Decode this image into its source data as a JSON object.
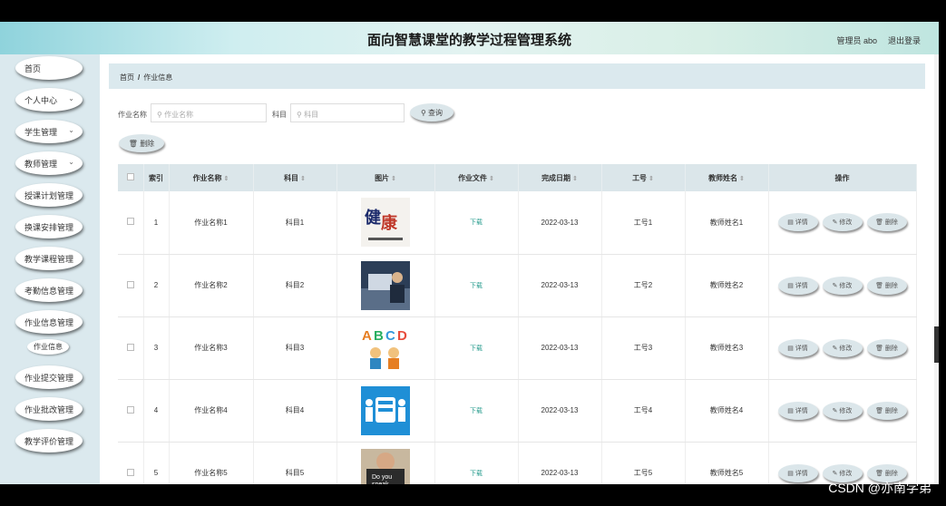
{
  "header": {
    "title": "面向智慧课堂的教学过程管理系统",
    "admin": "管理员 abo",
    "logout": "退出登录"
  },
  "sidebar": {
    "items": [
      {
        "label": "首页",
        "expandable": false
      },
      {
        "label": "个人中心",
        "expandable": true
      },
      {
        "label": "学生管理",
        "expandable": true
      },
      {
        "label": "教师管理",
        "expandable": true
      },
      {
        "label": "授课计划管理",
        "expandable": false
      },
      {
        "label": "换课安排管理",
        "expandable": false
      },
      {
        "label": "教学课程管理",
        "expandable": false
      },
      {
        "label": "考勤信息管理",
        "expandable": false
      },
      {
        "label": "作业信息管理",
        "expandable": false
      }
    ],
    "sub_item": "作业信息",
    "items_after": [
      {
        "label": "作业提交管理"
      },
      {
        "label": "作业批改管理"
      },
      {
        "label": "教学评价管理"
      }
    ]
  },
  "breadcrumb": {
    "home": "首页",
    "sep": "/",
    "current": "作业信息"
  },
  "search": {
    "name_label": "作业名称",
    "name_placeholder": "作业名称",
    "subject_label": "科目",
    "subject_placeholder": "科目",
    "query_button": "查询",
    "delete_button": "删除"
  },
  "table": {
    "headers": [
      "索引",
      "作业名称",
      "科目",
      "图片",
      "作业文件",
      "完成日期",
      "工号",
      "教师姓名",
      "操作"
    ],
    "rows": [
      {
        "index": "1",
        "name": "作业名称1",
        "subject": "科目1",
        "file": "下载",
        "date": "2022-03-13",
        "id": "工号1",
        "teacher": "教师姓名1"
      },
      {
        "index": "2",
        "name": "作业名称2",
        "subject": "科目2",
        "file": "下载",
        "date": "2022-03-13",
        "id": "工号2",
        "teacher": "教师姓名2"
      },
      {
        "index": "3",
        "name": "作业名称3",
        "subject": "科目3",
        "file": "下载",
        "date": "2022-03-13",
        "id": "工号3",
        "teacher": "教师姓名3"
      },
      {
        "index": "4",
        "name": "作业名称4",
        "subject": "科目4",
        "file": "下载",
        "date": "2022-03-13",
        "id": "工号4",
        "teacher": "教师姓名4"
      },
      {
        "index": "5",
        "name": "作业名称5",
        "subject": "科目5",
        "file": "下载",
        "date": "2022-03-13",
        "id": "工号5",
        "teacher": "教师姓名5"
      }
    ],
    "ops": {
      "detail": "详情",
      "edit": "修改",
      "delete": "删除"
    }
  },
  "watermark": "CSDN @亦南学弟"
}
